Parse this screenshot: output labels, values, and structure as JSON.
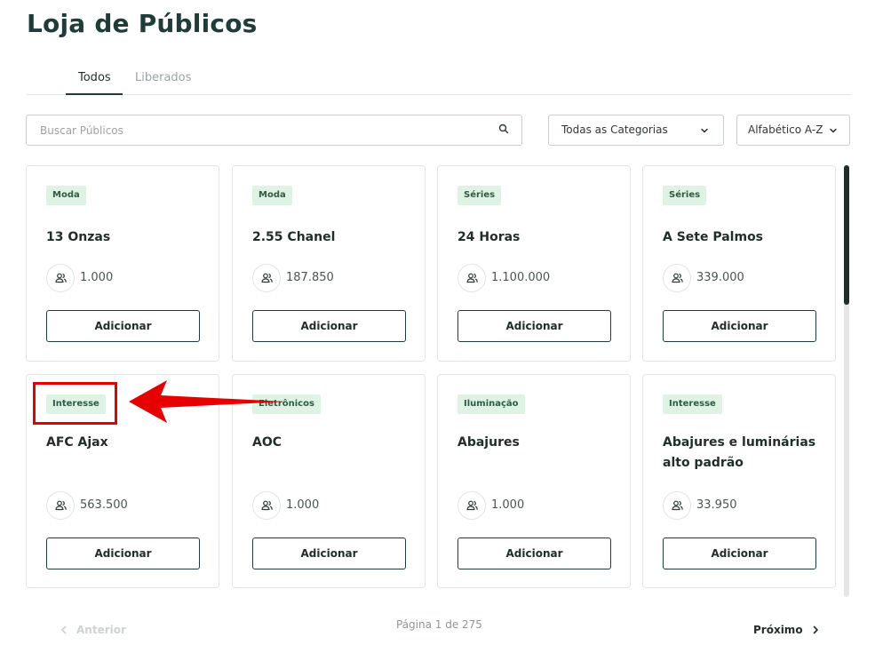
{
  "page": {
    "title": "Loja de Públicos"
  },
  "tabs": [
    {
      "label": "Todos",
      "active": true
    },
    {
      "label": "Liberados",
      "active": false
    }
  ],
  "search": {
    "placeholder": "Buscar Públicos",
    "value": ""
  },
  "filters": {
    "category": "Todas as Categorias",
    "sort": "Alfabético A-Z"
  },
  "cards": [
    {
      "category": "Moda",
      "title": "13 Onzas",
      "audience": "1.000",
      "button": "Adicionar"
    },
    {
      "category": "Moda",
      "title": "2.55 Chanel",
      "audience": "187.850",
      "button": "Adicionar"
    },
    {
      "category": "Séries",
      "title": "24 Horas",
      "audience": "1.100.000",
      "button": "Adicionar"
    },
    {
      "category": "Séries",
      "title": "A Sete Palmos",
      "audience": "339.000",
      "button": "Adicionar"
    },
    {
      "category": "Interesse",
      "title": "AFC Ajax",
      "audience": "563.500",
      "button": "Adicionar"
    },
    {
      "category": "Eletrônicos",
      "title": "AOC",
      "audience": "1.000",
      "button": "Adicionar"
    },
    {
      "category": "Iluminação",
      "title": "Abajures",
      "audience": "1.000",
      "button": "Adicionar"
    },
    {
      "category": "Interesse",
      "title": "Abajures e luminárias alto padrão",
      "audience": "33.950",
      "button": "Adicionar"
    }
  ],
  "pagination": {
    "prev_label": "Anterior",
    "info": "Página 1 de 275",
    "next_label": "Próximo"
  },
  "colors": {
    "primary": "#1e3d3a",
    "badge_bg": "#dff3e4",
    "badge_text": "#2e5b44",
    "annotation": "#e60000"
  },
  "icons": {
    "search": "search-icon",
    "chevron": "chevron-down-icon",
    "audience": "people-icon",
    "prev": "chevron-left-icon",
    "next": "chevron-right-icon"
  }
}
